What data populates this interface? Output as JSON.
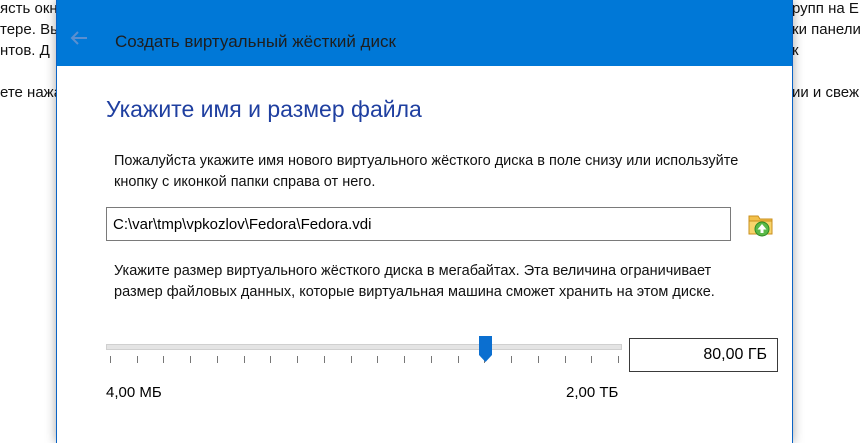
{
  "background": {
    "left_lines": [
      "ясть окн",
      "тере. Вы",
      "нтов. Д",
      "ете нажа"
    ],
    "right_lines": [
      "рупп на Е",
      "ки панели",
      "к",
      "ии и свеж"
    ]
  },
  "dialog": {
    "title": "Создать виртуальный жёсткий диск",
    "back_icon": "arrow-left-icon",
    "heading": "Укажите имя и размер файла",
    "name_instruction": "Пожалуйста укажите имя нового виртуального жёсткого диска в поле снизу или используйте кнопку с иконкой папки справа от него.",
    "file_path": "C:\\var\\tmp\\vpkozlov\\Fedora\\Fedora.vdi",
    "folder_icon": "folder-icon",
    "size_instruction": "Укажите размер виртуального жёсткого диска в мегабайтах. Эта величина ограничивает размер файловых данных, которые виртуальная машина сможет хранить на этом диске.",
    "size_slider": {
      "value_fraction": 0.735,
      "min_label": "4,00 МБ",
      "max_label": "2,00 ТБ"
    },
    "size_value": "80,00 ГБ"
  },
  "colors": {
    "titlebar": "#0078d7",
    "heading": "#1f3fa0",
    "slider_thumb": "#0b6fd0"
  }
}
